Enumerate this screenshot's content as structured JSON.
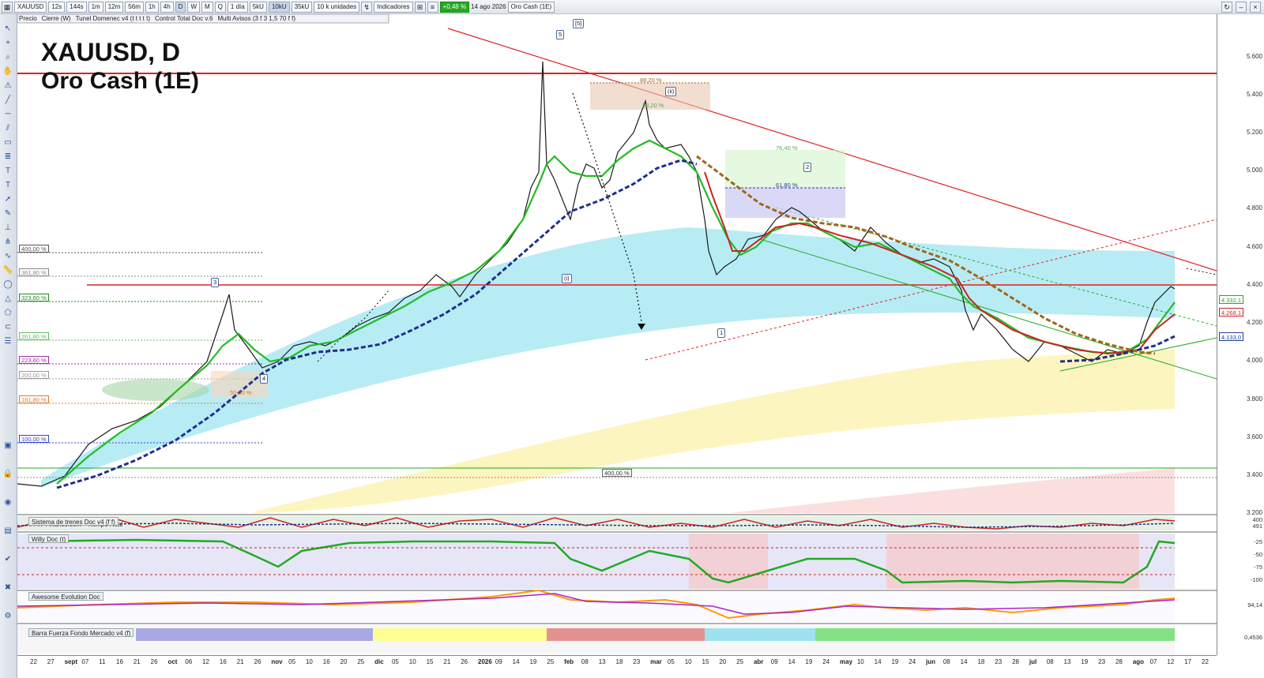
{
  "toolbar": {
    "symbol": "XAUUSD",
    "timeframes": [
      "12s",
      "144s",
      "1m",
      "12m",
      "56m",
      "1h",
      "4h",
      "D",
      "W",
      "M",
      "Q"
    ],
    "period_select": "1 día",
    "volume_blocks": [
      "5kU",
      "10kU",
      "35kU"
    ],
    "units_select": "10 k unidades",
    "indicators_label": "Indicadores",
    "change_badge": "+0,48 %",
    "date": "14 ago 2026",
    "template": "Oro Cash (1E)"
  },
  "legend_bar": {
    "items": [
      "Precio",
      "Cierre (W)",
      "Tunel Domenec v4 (t t t t t)",
      "Control Total Doc v.6",
      "Multi Avisos (3 f 3 1,5 70 f f)"
    ]
  },
  "chart_title": {
    "line1": "XAUUSD, D",
    "line2": "Oro Cash (1E)"
  },
  "price_axis": {
    "ticks": [
      "5.600",
      "5.400",
      "5.200",
      "5.000",
      "4.800",
      "4.600",
      "4.400",
      "4.200",
      "4.000",
      "3.800",
      "3.600",
      "3.400",
      "3.200"
    ],
    "tags": [
      {
        "value": "4.332,1",
        "color": "#22aa22"
      },
      {
        "value": "4.268,1",
        "color": "#cc2222"
      },
      {
        "value": "4.133,0",
        "color": "#1f3f99"
      }
    ]
  },
  "fib_levels_left": [
    {
      "label": "400,00 %",
      "color": "#555555"
    },
    {
      "label": "361,80 %",
      "color": "#888888"
    },
    {
      "label": "323,60 %",
      "color": "#228822"
    },
    {
      "label": "261,80 %",
      "color": "#66bb66"
    },
    {
      "label": "223,60 %",
      "color": "#993399"
    },
    {
      "label": "200,00 %",
      "color": "#999999"
    },
    {
      "label": "161,80 %",
      "color": "#dd7733"
    },
    {
      "label": "100,00 %",
      "color": "#3344cc"
    }
  ],
  "fib_other": {
    "top_88": "88,20 %",
    "fib_76": "76,40 %",
    "fib_61": "61,80 %",
    "fib_38": "38,20 %",
    "fib_50": "50,00 %",
    "bottom_400": "400,00 %"
  },
  "waves": [
    "5",
    "[5]",
    "(ii)",
    "(i)",
    "1",
    "2",
    "3",
    "4"
  ],
  "source_label": "IT-Finance.com - Tiempo Real",
  "panels": [
    {
      "name": "Sistema de trenes Doc v4 (f f)",
      "axis": [
        "400",
        "491"
      ]
    },
    {
      "name": "Willy Doc (t)",
      "axis": [
        "-25",
        "-50",
        "-75",
        "-100"
      ]
    },
    {
      "name": "Awesome Evolution Doc",
      "axis": [
        "94,14"
      ]
    },
    {
      "name": "Barra Fuerza Fondo Mercado v4 (f)",
      "axis": [
        "0,4536"
      ]
    }
  ],
  "x_axis": [
    {
      "t": "22",
      "m": false
    },
    {
      "t": "27",
      "m": false
    },
    {
      "t": "sept",
      "m": true
    },
    {
      "t": "07",
      "m": false
    },
    {
      "t": "11",
      "m": false
    },
    {
      "t": "16",
      "m": false
    },
    {
      "t": "21",
      "m": false
    },
    {
      "t": "26",
      "m": false
    },
    {
      "t": "oct",
      "m": true
    },
    {
      "t": "06",
      "m": false
    },
    {
      "t": "12",
      "m": false
    },
    {
      "t": "16",
      "m": false
    },
    {
      "t": "21",
      "m": false
    },
    {
      "t": "26",
      "m": false
    },
    {
      "t": "nov",
      "m": true
    },
    {
      "t": "05",
      "m": false
    },
    {
      "t": "10",
      "m": false
    },
    {
      "t": "16",
      "m": false
    },
    {
      "t": "20",
      "m": false
    },
    {
      "t": "25",
      "m": false
    },
    {
      "t": "dic",
      "m": true
    },
    {
      "t": "05",
      "m": false
    },
    {
      "t": "10",
      "m": false
    },
    {
      "t": "15",
      "m": false
    },
    {
      "t": "21",
      "m": false
    },
    {
      "t": "26",
      "m": false
    },
    {
      "t": "2026",
      "m": true
    },
    {
      "t": "09",
      "m": false
    },
    {
      "t": "14",
      "m": false
    },
    {
      "t": "19",
      "m": false
    },
    {
      "t": "25",
      "m": false
    },
    {
      "t": "feb",
      "m": true
    },
    {
      "t": "08",
      "m": false
    },
    {
      "t": "13",
      "m": false
    },
    {
      "t": "18",
      "m": false
    },
    {
      "t": "23",
      "m": false
    },
    {
      "t": "mar",
      "m": true
    },
    {
      "t": "05",
      "m": false
    },
    {
      "t": "10",
      "m": false
    },
    {
      "t": "15",
      "m": false
    },
    {
      "t": "20",
      "m": false
    },
    {
      "t": "25",
      "m": false
    },
    {
      "t": "abr",
      "m": true
    },
    {
      "t": "09",
      "m": false
    },
    {
      "t": "14",
      "m": false
    },
    {
      "t": "19",
      "m": false
    },
    {
      "t": "24",
      "m": false
    },
    {
      "t": "may",
      "m": true
    },
    {
      "t": "10",
      "m": false
    },
    {
      "t": "14",
      "m": false
    },
    {
      "t": "19",
      "m": false
    },
    {
      "t": "24",
      "m": false
    },
    {
      "t": "jun",
      "m": true
    },
    {
      "t": "08",
      "m": false
    },
    {
      "t": "14",
      "m": false
    },
    {
      "t": "18",
      "m": false
    },
    {
      "t": "23",
      "m": false
    },
    {
      "t": "28",
      "m": false
    },
    {
      "t": "jul",
      "m": true
    },
    {
      "t": "08",
      "m": false
    },
    {
      "t": "13",
      "m": false
    },
    {
      "t": "19",
      "m": false
    },
    {
      "t": "23",
      "m": false
    },
    {
      "t": "28",
      "m": false
    },
    {
      "t": "ago",
      "m": true
    },
    {
      "t": "07",
      "m": false
    },
    {
      "t": "12",
      "m": false
    },
    {
      "t": "17",
      "m": false
    },
    {
      "t": "22",
      "m": false
    }
  ],
  "colors": {
    "resistance": "#e02020",
    "support_green": "#22aa22",
    "ema_blue": "#1f2f8f",
    "ma_brown": "#a0661a",
    "cloud_cyan": "#9fe6f2",
    "cloud_yellow": "#fbf3b4"
  }
}
